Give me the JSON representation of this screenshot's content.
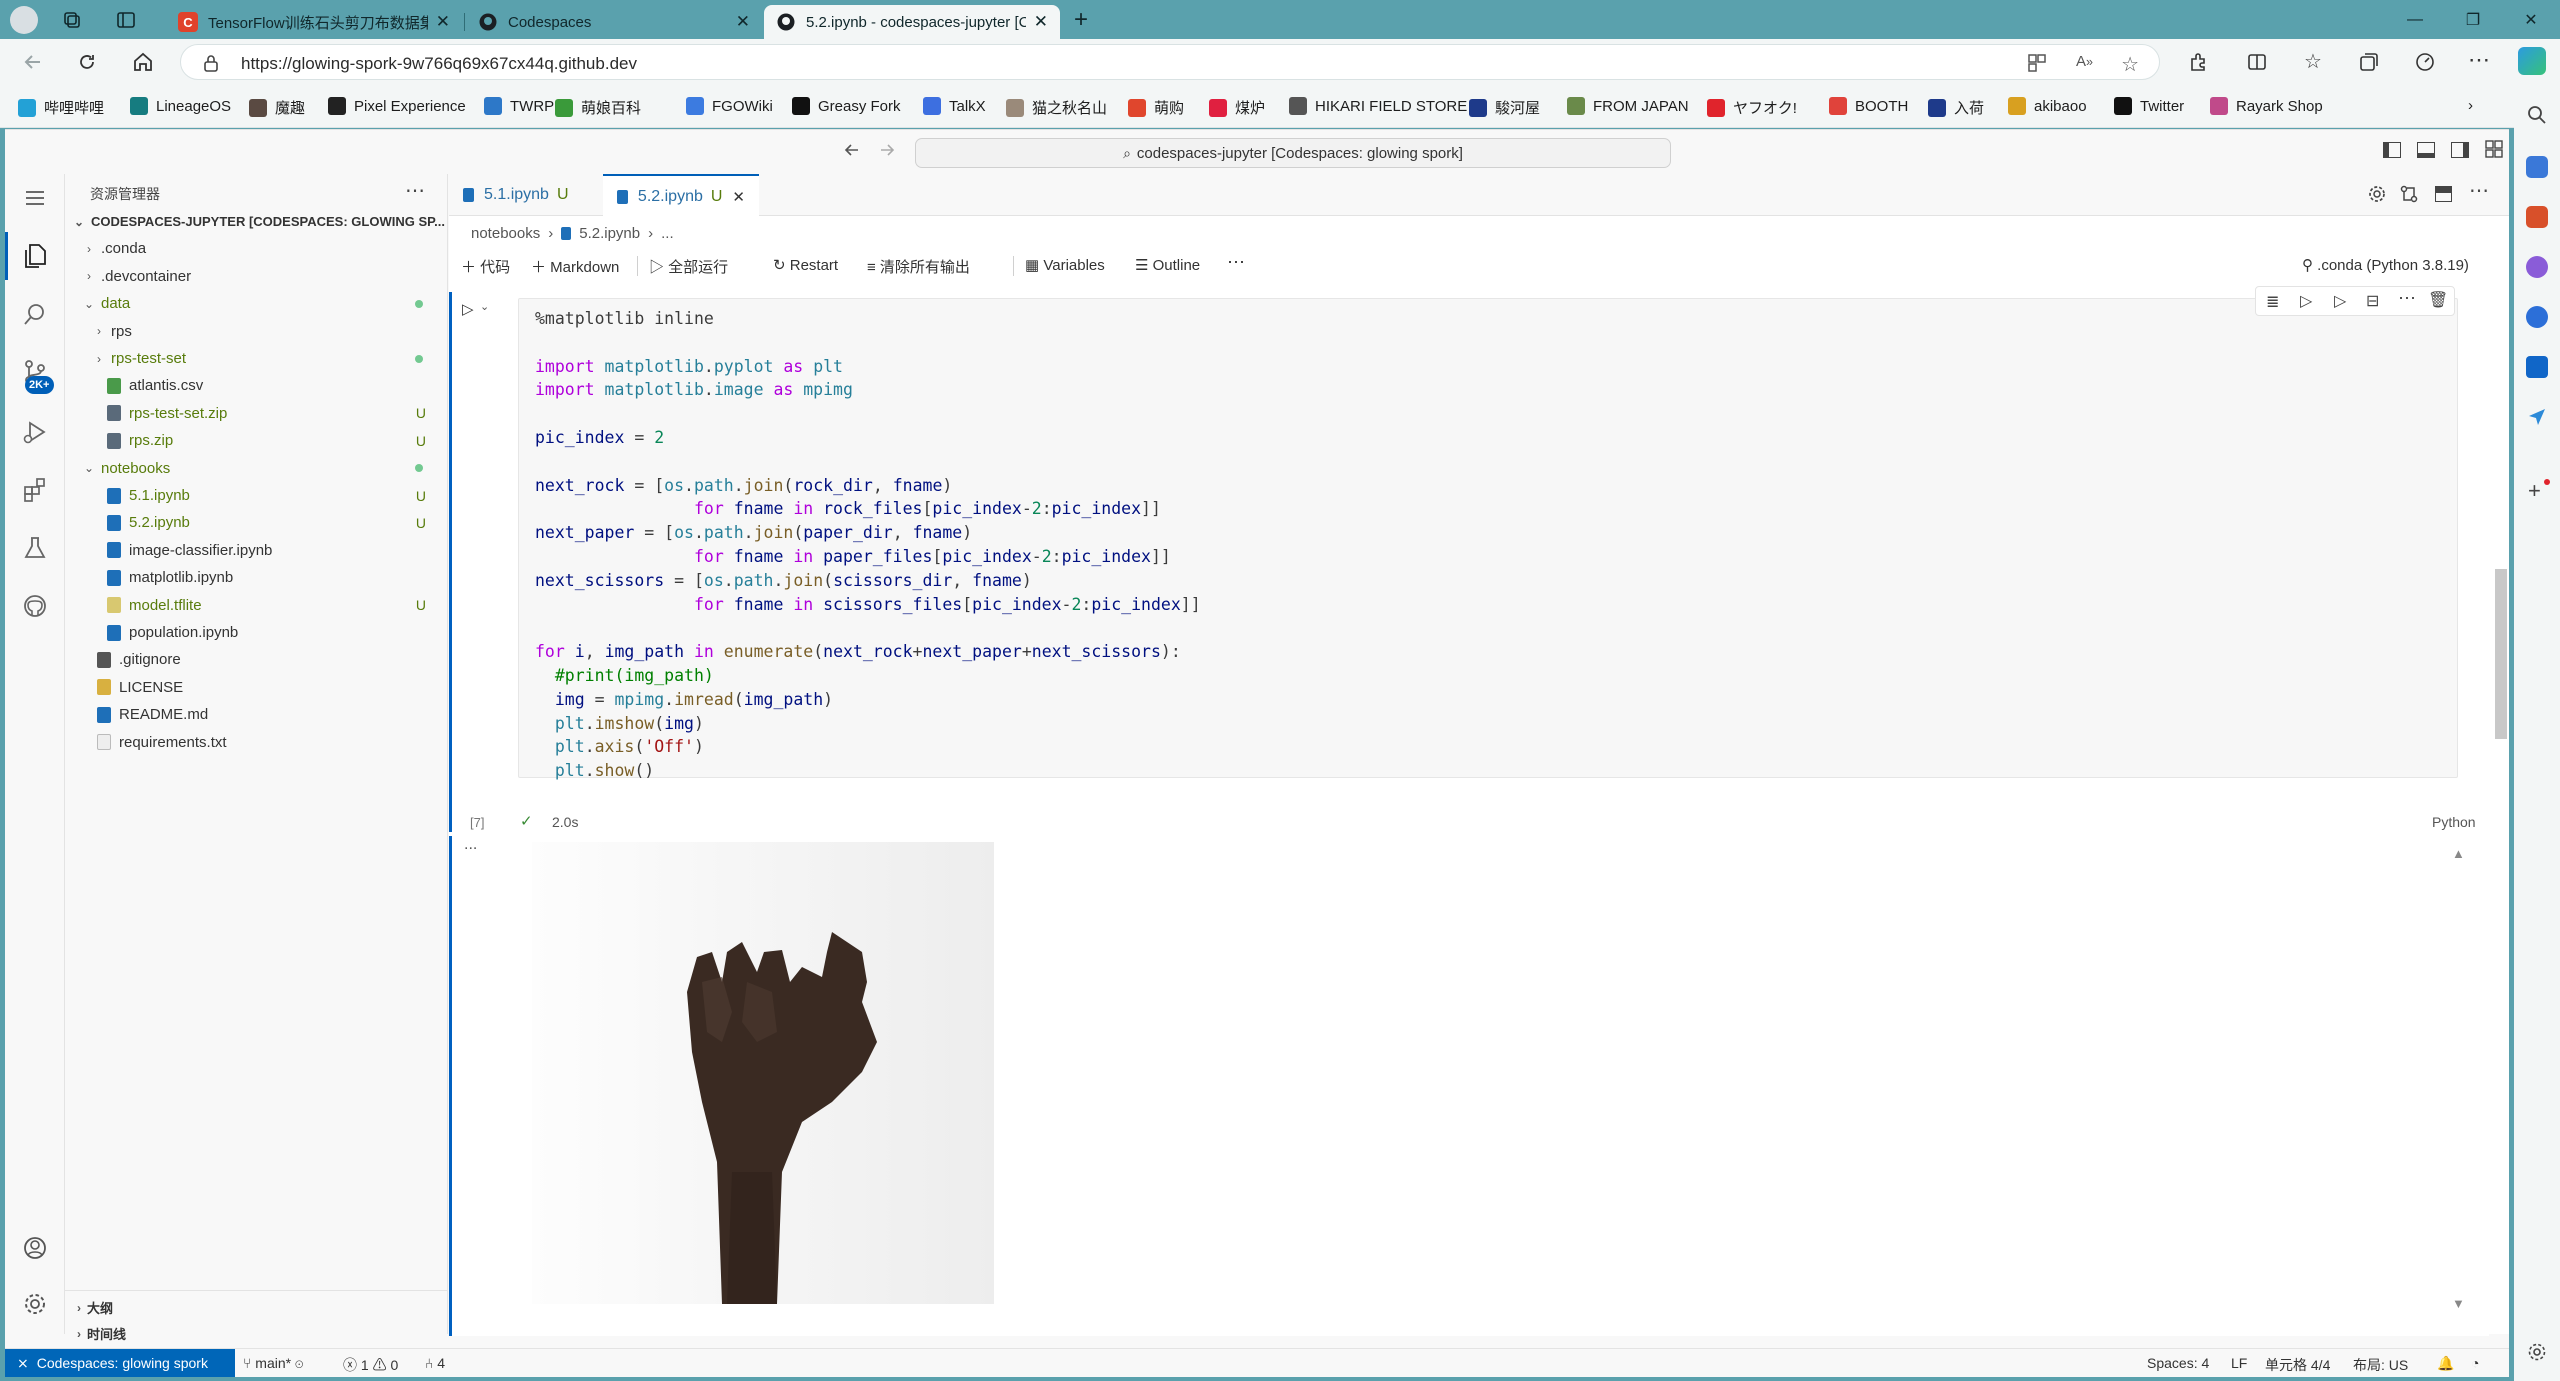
{
  "browser": {
    "tabs": [
      {
        "title": "TensorFlow训练石头剪刀布数据集",
        "favicon_color": "#e0422b"
      },
      {
        "title": "Codespaces",
        "favicon_color": "#1b1f23"
      },
      {
        "title": "5.2.ipynb - codespaces-jupyter [C",
        "favicon_color": "#1b1f23"
      }
    ],
    "url": "https://glowing-spork-9w766q69x67cx44q.github.dev",
    "bookmarks": [
      {
        "label": "哔哩哔哩",
        "color": "#23a1d6"
      },
      {
        "label": "LineageOS",
        "color": "#167c80"
      },
      {
        "label": "魔趣",
        "color": "#5a4a42"
      },
      {
        "label": "Pixel Experience",
        "color": "#222222"
      },
      {
        "label": "TWRP",
        "color": "#2d78c8"
      },
      {
        "label": "萌娘百科",
        "color": "#3a9a3a"
      },
      {
        "label": "FGOWiki",
        "color": "#3c7be0"
      },
      {
        "label": "Greasy Fork",
        "color": "#111111"
      },
      {
        "label": "TalkX",
        "color": "#3d6fe0"
      },
      {
        "label": "猫之秋名山",
        "color": "#9a8a7a"
      },
      {
        "label": "萌购",
        "color": "#e0462d"
      },
      {
        "label": "煤炉",
        "color": "#e02040"
      },
      {
        "label": "HIKARI FIELD STORE",
        "color": "#555555"
      },
      {
        "label": "駿河屋",
        "color": "#1e3a8a"
      },
      {
        "label": "FROM JAPAN",
        "color": "#6a8a4a"
      },
      {
        "label": "ヤフオク!",
        "color": "#e0242c"
      },
      {
        "label": "BOOTH",
        "color": "#e0433b"
      },
      {
        "label": "入荷",
        "color": "#1e3a8a"
      },
      {
        "label": "akibaoo",
        "color": "#d8a020"
      },
      {
        "label": "Twitter",
        "color": "#111111"
      },
      {
        "label": "Rayark Shop",
        "color": "#c04a8a"
      }
    ]
  },
  "vscode": {
    "command_center": "codespaces-jupyter [Codespaces: glowing spork]",
    "explorer_title": "资源管理器",
    "activity_badge": "2K+",
    "tree": [
      {
        "label": "CODESPACES-JUPYTER [CODESPACES: GLOWING SP...",
        "indent": 0,
        "kind": "root"
      },
      {
        "label": ".conda",
        "indent": 1,
        "kind": "folder"
      },
      {
        "label": ".devcontainer",
        "indent": 1,
        "kind": "folder"
      },
      {
        "label": "data",
        "indent": 1,
        "kind": "folder-open",
        "green": true,
        "dot": true
      },
      {
        "label": "rps",
        "indent": 2,
        "kind": "folder"
      },
      {
        "label": "rps-test-set",
        "indent": 2,
        "kind": "folder",
        "green": true,
        "dot": true
      },
      {
        "label": "atlantis.csv",
        "indent": 2,
        "kind": "csv"
      },
      {
        "label": "rps-test-set.zip",
        "indent": 2,
        "kind": "zip",
        "green": true,
        "badge": "U"
      },
      {
        "label": "rps.zip",
        "indent": 2,
        "kind": "zip",
        "green": true,
        "badge": "U"
      },
      {
        "label": "notebooks",
        "indent": 1,
        "kind": "folder-open",
        "green": true,
        "dot": true
      },
      {
        "label": "5.1.ipynb",
        "indent": 2,
        "kind": "nb",
        "green": true,
        "badge": "U"
      },
      {
        "label": "5.2.ipynb",
        "indent": 2,
        "kind": "nb",
        "green": true,
        "badge": "U"
      },
      {
        "label": "image-classifier.ipynb",
        "indent": 2,
        "kind": "nb"
      },
      {
        "label": "matplotlib.ipynb",
        "indent": 2,
        "kind": "nb"
      },
      {
        "label": "model.tflite",
        "indent": 2,
        "kind": "file",
        "green": true,
        "badge": "U"
      },
      {
        "label": "population.ipynb",
        "indent": 2,
        "kind": "nb"
      },
      {
        "label": ".gitignore",
        "indent": 1,
        "kind": "git"
      },
      {
        "label": "LICENSE",
        "indent": 1,
        "kind": "license"
      },
      {
        "label": "README.md",
        "indent": 1,
        "kind": "info"
      },
      {
        "label": "requirements.txt",
        "indent": 1,
        "kind": "txt"
      }
    ],
    "outline_label": "大纲",
    "timeline_label": "时间线",
    "editor_tabs": [
      {
        "label": "5.1.ipynb",
        "badge": "U"
      },
      {
        "label": "5.2.ipynb",
        "badge": "U"
      }
    ],
    "breadcrumb": [
      "notebooks",
      "5.2.ipynb",
      "..."
    ],
    "nb_toolbar": {
      "code": "代码",
      "markdown": "Markdown",
      "run_all": "全部运行",
      "restart": "Restart",
      "clear": "清除所有输出",
      "variables": "Variables",
      "outline": "Outline"
    },
    "kernel": ".conda (Python 3.8.19)",
    "exec_count": "[7]",
    "exec_time": "2.0s",
    "cell_lang": "Python",
    "output_ellipsis": "...",
    "status": {
      "remote": "Codespaces: glowing spork",
      "branch": "main*",
      "errors": "1",
      "warnings": "0",
      "ports": "4",
      "spaces": "Spaces: 4",
      "eol": "LF",
      "cell": "单元格 4/4",
      "layout": "布局: US"
    }
  }
}
